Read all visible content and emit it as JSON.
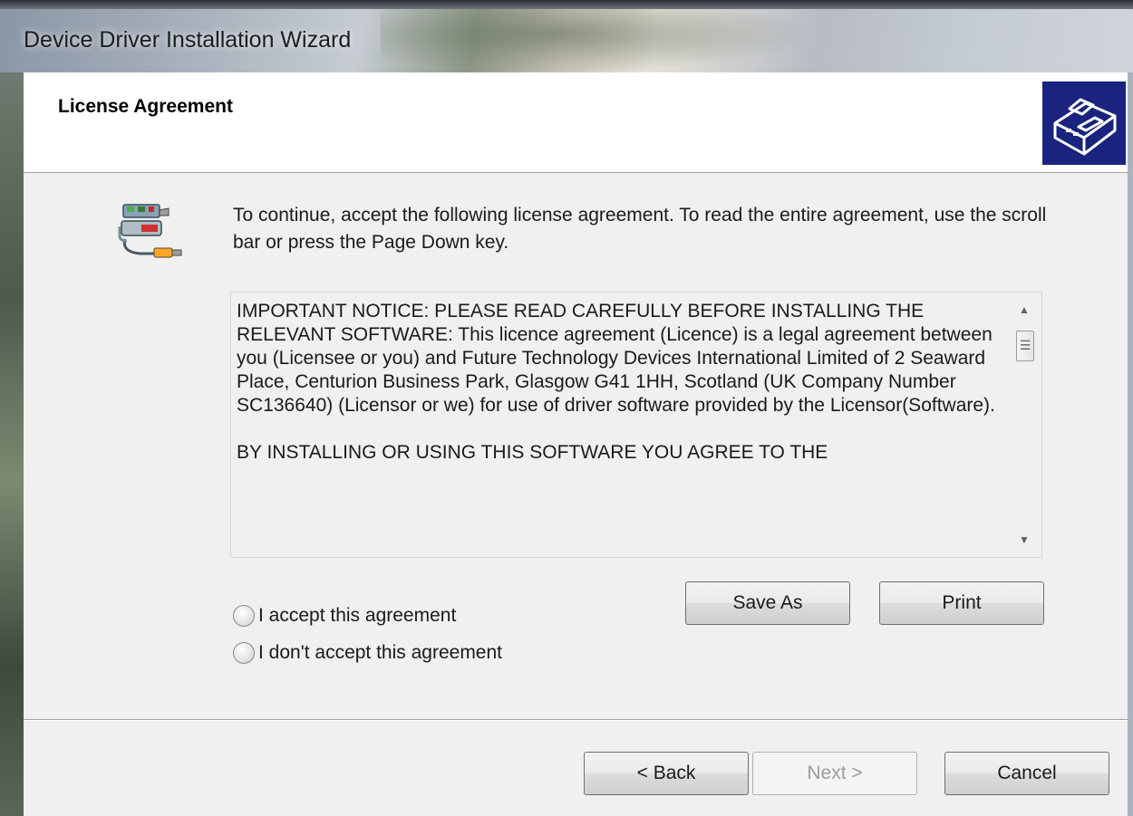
{
  "window": {
    "title": "Device Driver Installation Wizard"
  },
  "header": {
    "title": "License Agreement",
    "icon": "hardware-install-icon"
  },
  "intro": {
    "icon": "usb-device-icon",
    "text": "To continue, accept the following license agreement. To read the entire agreement, use the scroll bar or press the Page Down key."
  },
  "license": {
    "paragraphs": [
      "IMPORTANT NOTICE: PLEASE READ CAREFULLY BEFORE INSTALLING THE RELEVANT SOFTWARE: This licence agreement (Licence) is a legal agreement between you (Licensee or you) and Future Technology Devices International Limited of 2 Seaward Place, Centurion Business Park, Glasgow G41 1HH, Scotland (UK Company Number SC136640) (Licensor or we) for use of driver software provided by the Licensor(Software).",
      "BY INSTALLING OR USING THIS SOFTWARE YOU AGREE TO THE"
    ],
    "scroll_up": "▲",
    "scroll_down": "▼",
    "scroll_grip": "☰"
  },
  "options": {
    "accept_label": "I accept this agreement",
    "decline_label": "I don't accept this agreement"
  },
  "actions": {
    "save_as": "Save As",
    "print": "Print"
  },
  "nav": {
    "back": "< Back",
    "next": "Next >",
    "cancel": "Cancel"
  },
  "colors": {
    "dialog_bg": "#f0f0f0",
    "header_bg": "#ffffff",
    "icon_bg": "#1a237e"
  }
}
